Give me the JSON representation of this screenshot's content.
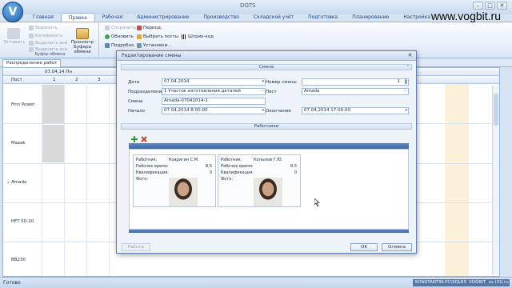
{
  "window": {
    "title": "DOTS",
    "logo_letter": "V",
    "watermark": "www.vogbit.ru",
    "controls": [
      "–",
      "□",
      "✕"
    ]
  },
  "ribbon_tabs": [
    "Главная",
    "Правка",
    "Рабочая",
    "Администрирование",
    "Производство",
    "Складской учёт",
    "Подготовка",
    "Планирование",
    "Настройка"
  ],
  "ribbon": {
    "clipboard": {
      "paste": "Вставить",
      "cut": "Вырезать",
      "copy": "Копировать",
      "select_all": "Выделить всё",
      "select_all_2": "Выделить все",
      "preview_1": "Просмотр",
      "preview_2": "Буфера обмена",
      "group_label": "Буфер обмена"
    },
    "actions": {
      "save": "Сохранить",
      "refresh": "Обновить",
      "details": "Подробно",
      "period": "Период:",
      "select_posts": "Выбрать посты",
      "barcode": "Штрих-код",
      "settings": "Установки..."
    }
  },
  "doc_tab": "Распределение работ",
  "grid": {
    "date_header": "07.04.14 Пн",
    "post_header": "Пост",
    "columns": [
      "1",
      "2",
      "3"
    ],
    "rows": [
      "Finn Power",
      "Mazak",
      "Amada",
      "HFT 50-20",
      "BB230"
    ]
  },
  "dialog": {
    "title": "Редактирование смены",
    "section_shift": "Смена",
    "section_workers": "Работники",
    "fields": {
      "date_label": "Дата",
      "date_value": "07.04.2014",
      "shift_no_label": "Номер смены",
      "shift_no_value": "1",
      "division_label": "Подразделение",
      "division_value": "1 Участок изготовления деталей",
      "post_label": "Пост",
      "post_value": "Amada",
      "shift_label": "Смена",
      "shift_value": "Amada-07042014-1",
      "start_label": "Начало",
      "start_value": "07.04.2014 8:00:00",
      "end_label": "Окончание",
      "end_value": "07.04.2014 17:00:00"
    },
    "workers": [
      {
        "worker_label": "Работник:",
        "name": "Ковригин С.М.",
        "work_time_label": "Рабочее время:",
        "work_time": "8,5",
        "qualification_label": "Квалификация:",
        "qualification": "0",
        "photo_label": "Фото:"
      },
      {
        "worker_label": "Работник:",
        "name": "Копылов Г.Ю.",
        "work_time_label": "Рабочее время:",
        "work_time": "8,5",
        "qualification_label": "Квалификация:",
        "qualification": "0",
        "photo_label": "Фото:"
      }
    ],
    "buttons": {
      "workers": "Работы",
      "ok": "OK",
      "cancel": "Отмена"
    }
  },
  "status": {
    "text": "Готово",
    "cells": [
      "KONSTANTIN-PC\\SQLEXPRESS",
      "VOGBIT",
      "ss (31)",
      "ru"
    ]
  }
}
